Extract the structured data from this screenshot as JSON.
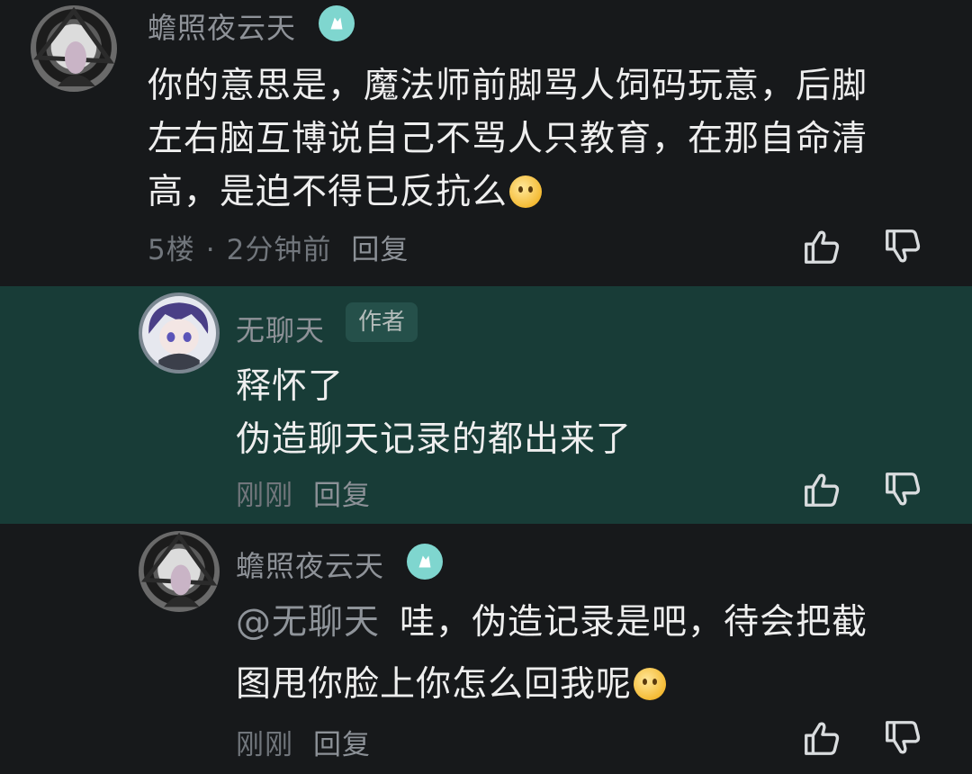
{
  "comments": [
    {
      "username": "蟾照夜云天",
      "verified_icon": "verified-badge-icon",
      "text_lines": [
        "你的意思是，魔法师前脚骂人饲码玩意，后脚",
        "左右脑互博说自己不骂人只教育，在那自命清",
        "高，是迫不得已反抗么"
      ],
      "emoji": "smirk-emoji",
      "floor": "5楼",
      "separator": "·",
      "time": "2分钟前",
      "reply_label": "回复"
    },
    {
      "username": "无聊天",
      "author_tag": "作者",
      "text_lines": [
        "释怀了",
        "伪造聊天记录的都出来了"
      ],
      "time": "刚刚",
      "reply_label": "回复"
    },
    {
      "username": "蟾照夜云天",
      "verified_icon": "verified-badge-icon",
      "mention": "@无聊天",
      "text_lines": [
        "哇，伪造记录是吧，待会把截",
        "图甩你脸上你怎么回我呢"
      ],
      "emoji": "grin-emoji",
      "time": "刚刚",
      "reply_label": "回复"
    }
  ],
  "icons": {
    "like": "thumbs-up-icon",
    "dislike": "thumbs-down-icon"
  },
  "colors": {
    "background": "#17191b",
    "highlight_background": "#183c37",
    "text": "#eeeeee",
    "muted": "#8e9298",
    "badge": "#7fd6cf"
  }
}
